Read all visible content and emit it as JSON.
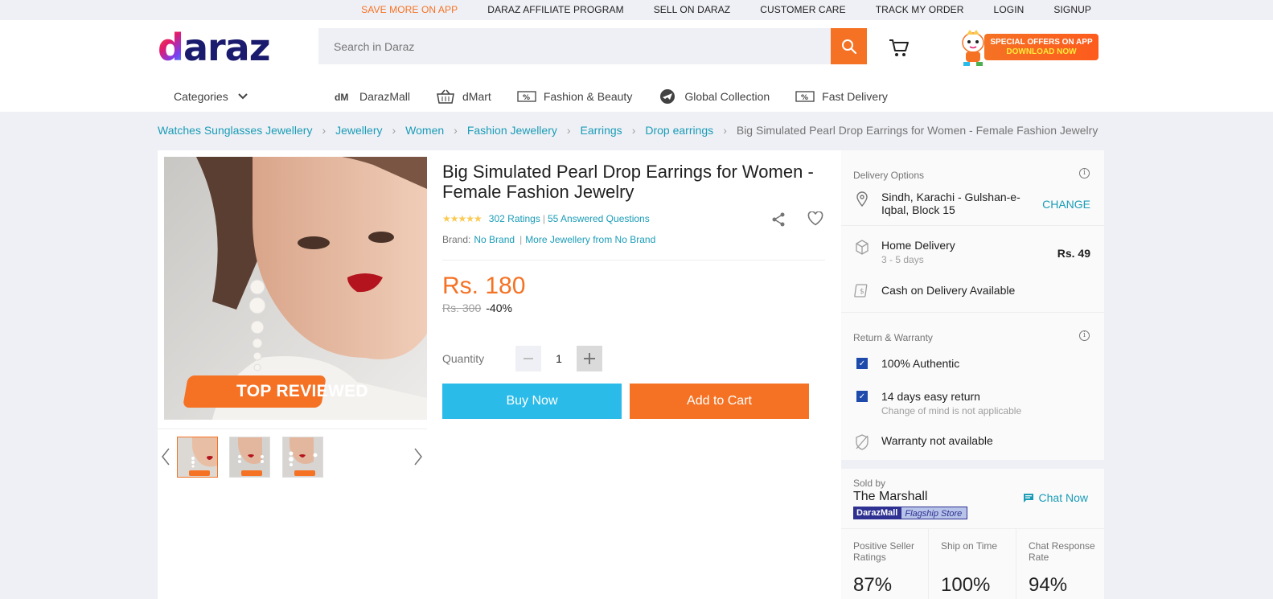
{
  "topbar": {
    "links": [
      "SAVE MORE ON APP",
      "DARAZ AFFILIATE PROGRAM",
      "SELL ON DARAZ",
      "CUSTOMER CARE",
      "TRACK MY ORDER",
      "LOGIN",
      "SIGNUP"
    ]
  },
  "header": {
    "logo_first": "d",
    "logo_rest": "araz",
    "search_placeholder": "Search in Daraz",
    "promo_line1": "SPECIAL OFFERS ON APP",
    "promo_line2": "DOWNLOAD NOW",
    "categories_label": "Categories",
    "nav": [
      {
        "label": "DarazMall",
        "icon": "darazmall-icon"
      },
      {
        "label": "dMart",
        "icon": "basket-icon"
      },
      {
        "label": "Fashion & Beauty",
        "icon": "discount-tag-icon"
      },
      {
        "label": "Global Collection",
        "icon": "plane-globe-icon"
      },
      {
        "label": "Fast Delivery",
        "icon": "discount-tag-icon"
      }
    ]
  },
  "breadcrumb": {
    "items": [
      "Watches Sunglasses Jewellery",
      "Jewellery",
      "Women",
      "Fashion Jewellery",
      "Earrings",
      "Drop earrings"
    ],
    "current": "Big Simulated Pearl Drop Earrings for Women - Female Fashion Jewelry"
  },
  "product": {
    "image_badge": "TOP REVIEWED",
    "title": "Big Simulated Pearl Drop Earrings for Women - Female Fashion Jewelry",
    "stars": "★★★★★",
    "rating_value": 4.5,
    "ratings": "302 Ratings",
    "questions": "55 Answered Questions",
    "brand_label": "Brand:",
    "brand": "No Brand",
    "more_from": "More Jewellery from No Brand",
    "price": "Rs. 180",
    "old_price": "Rs. 300",
    "discount": "-40%",
    "quantity_label": "Quantity",
    "quantity": "1",
    "buy_now": "Buy Now",
    "add_to_cart": "Add to Cart",
    "thumb_count": 3
  },
  "delivery": {
    "heading": "Delivery Options",
    "location": "Sindh, Karachi - Gulshan-e-Iqbal, Block 15",
    "change": "CHANGE",
    "home_delivery": "Home Delivery",
    "home_delivery_days": "3 - 5 days",
    "home_delivery_fee": "Rs. 49",
    "cod": "Cash on Delivery Available"
  },
  "warranty": {
    "heading": "Return & Warranty",
    "authentic": "100% Authentic",
    "return": "14 days easy return",
    "return_sub": "Change of mind is not applicable",
    "warranty": "Warranty not available"
  },
  "seller": {
    "sold_by": "Sold by",
    "name": "The Marshall",
    "badge_a": "DarazMall",
    "badge_b": "Flagship Store",
    "chat": "Chat Now",
    "metrics": [
      {
        "label": "Positive Seller Ratings",
        "value": "87%"
      },
      {
        "label": "Ship on Time",
        "value": "100%"
      },
      {
        "label": "Chat Response Rate",
        "value": "94%"
      }
    ]
  },
  "colors": {
    "accent": "#f57224",
    "link": "#1a9cb7",
    "buy": "#2abbe8",
    "star": "#faca51"
  }
}
